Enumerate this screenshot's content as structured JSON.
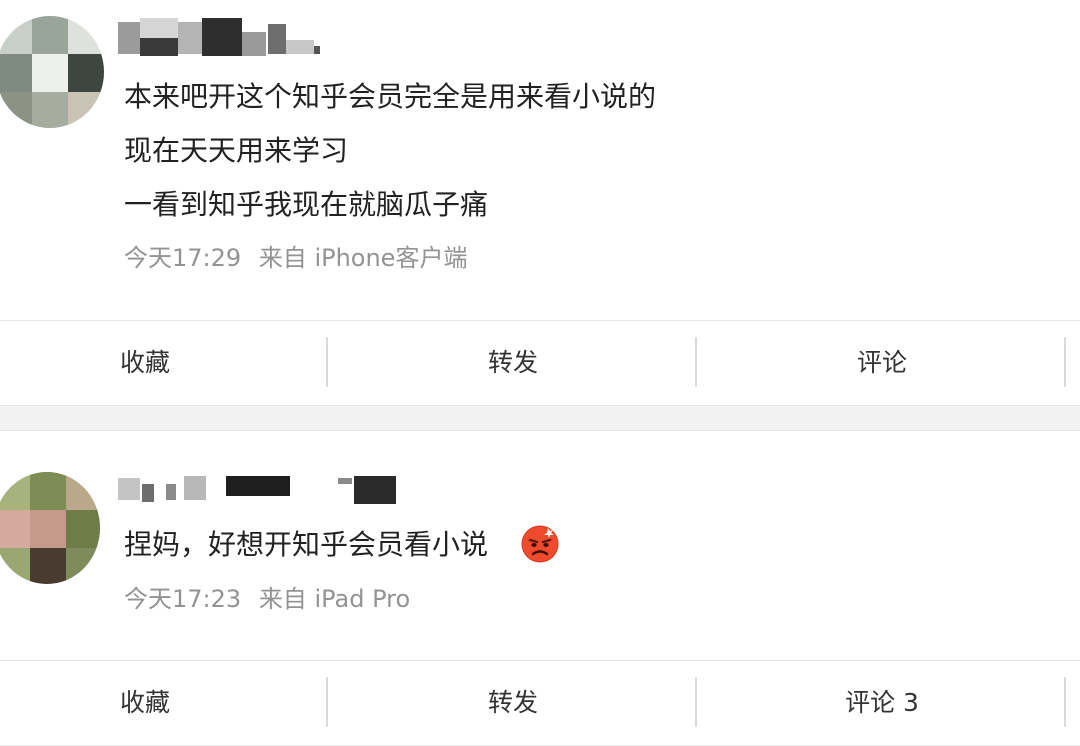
{
  "posts": [
    {
      "lines": [
        "本来吧开这个知乎会员完全是用来看小说的",
        "现在天天用来学习",
        "一看到知乎我现在就脑瓜子痛"
      ],
      "time": "今天17:29",
      "source": "来自 iPhone客户端",
      "actions": [
        "收藏",
        "转发",
        "评论"
      ]
    },
    {
      "lines": [
        "捏妈，好想开知乎会员看小说"
      ],
      "emoji": "angry-face-emoji",
      "time": "今天17:23",
      "source": "来自 iPad Pro",
      "actions": [
        "收藏",
        "转发",
        "评论 3"
      ]
    }
  ],
  "colors": {
    "text": "#222222",
    "meta": "#939393",
    "divider": "#dadada",
    "separator_band": "#f2f2f2"
  }
}
